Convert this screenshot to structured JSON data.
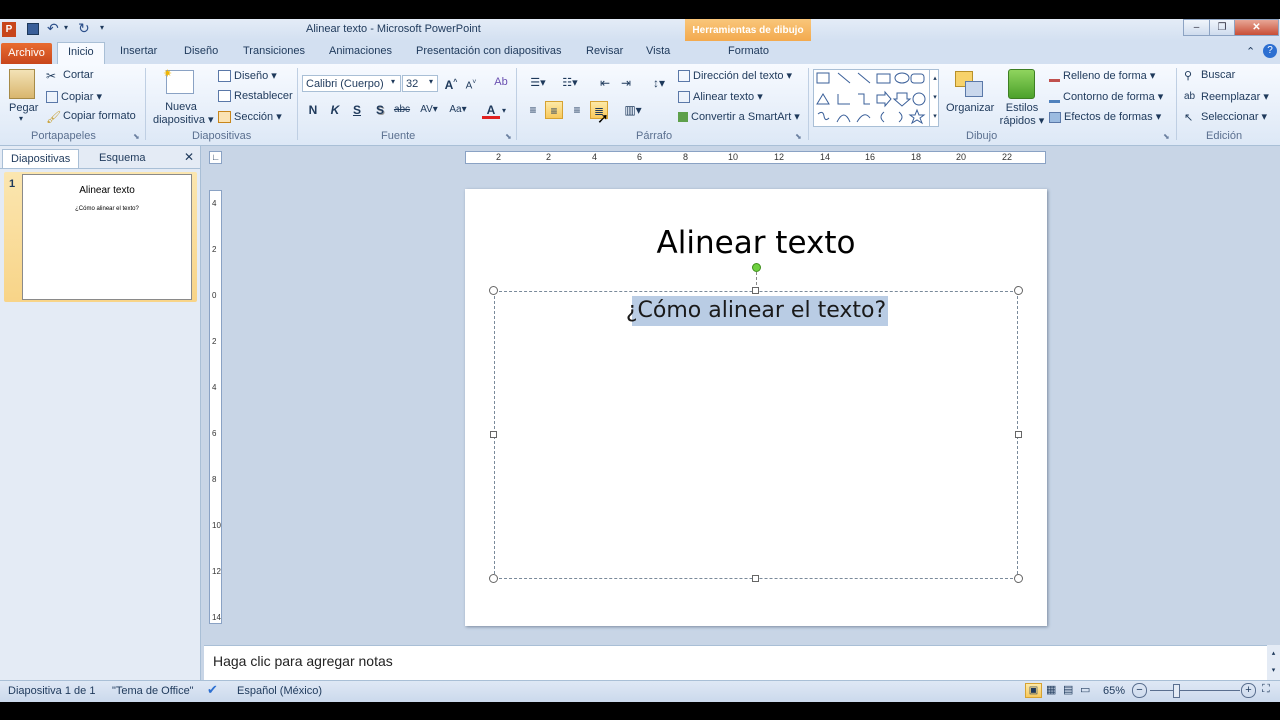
{
  "window": {
    "title": "Alinear texto  -  Microsoft PowerPoint",
    "context_group": "Herramientas de dibujo"
  },
  "tabs": [
    "Archivo",
    "Inicio",
    "Insertar",
    "Diseño",
    "Transiciones",
    "Animaciones",
    "Presentación con diapositivas",
    "Revisar",
    "Vista",
    "Formato"
  ],
  "clipboard": {
    "paste": "Pegar",
    "cut": "Cortar",
    "copy": "Copiar",
    "format_painter": "Copiar formato",
    "label": "Portapapeles"
  },
  "slides": {
    "new_line1": "Nueva",
    "new_line2": "diapositiva",
    "layout": "Diseño",
    "reset": "Restablecer",
    "section": "Sección",
    "label": "Diapositivas"
  },
  "font": {
    "name": "Calibri (Cuerpo)",
    "size": "32",
    "label": "Fuente"
  },
  "paragraph": {
    "direction": "Dirección del texto",
    "align": "Alinear texto",
    "smartart": "Convertir a SmartArt",
    "label": "Párrafo"
  },
  "drawing": {
    "arrange": "Organizar",
    "styles_line1": "Estilos",
    "styles_line2": "rápidos",
    "fill": "Relleno de forma",
    "outline": "Contorno de forma",
    "effects": "Efectos de formas",
    "label": "Dibujo"
  },
  "editing": {
    "find": "Buscar",
    "replace": "Reemplazar",
    "select": "Seleccionar",
    "label": "Edición"
  },
  "panel": {
    "tab_slides": "Diapositivas",
    "tab_outline": "Esquema",
    "slide_number": "1"
  },
  "slide": {
    "title": "Alinear texto",
    "subtitle": "¿Cómo alinear el texto?"
  },
  "ruler": {
    "h_labels": [
      "2",
      "2",
      "4",
      "6",
      "8",
      "10",
      "12",
      "14",
      "16",
      "18",
      "20",
      "22"
    ],
    "v_labels": [
      "4",
      "2",
      "0",
      "2",
      "4",
      "6",
      "8",
      "10",
      "12",
      "14"
    ]
  },
  "notes": {
    "placeholder": "Haga clic para agregar notas"
  },
  "status": {
    "slide_info": "Diapositiva 1 de 1",
    "theme": "\"Tema de Office\"",
    "language": "Español (México)",
    "zoom": "65%"
  }
}
